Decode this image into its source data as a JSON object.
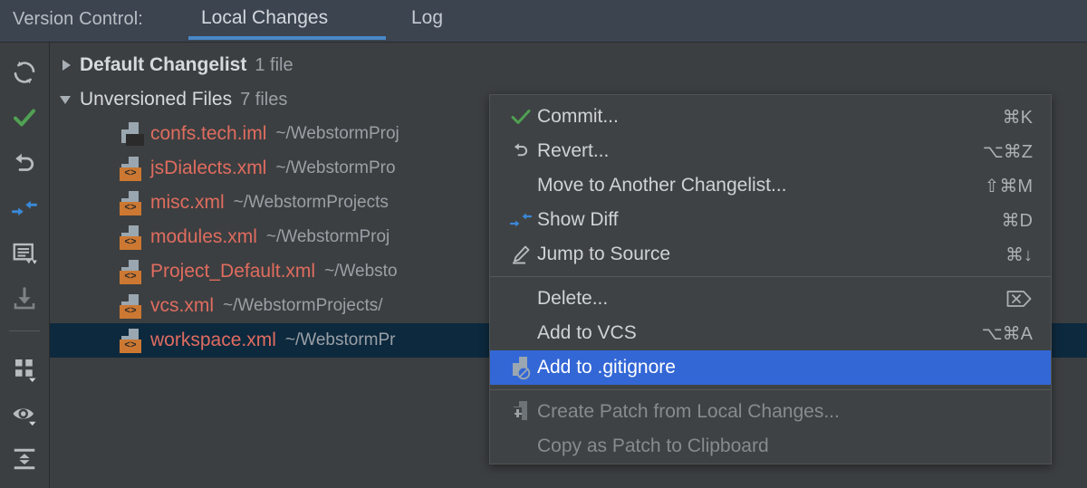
{
  "header": {
    "title": "Version Control:",
    "tabs": [
      {
        "label": "Local Changes",
        "active": true
      },
      {
        "label": "Log",
        "active": false
      }
    ]
  },
  "toolbar": {
    "items": [
      {
        "name": "refresh-icon",
        "label": "Refresh"
      },
      {
        "name": "commit-check-icon",
        "label": "Commit"
      },
      {
        "name": "revert-icon",
        "label": "Revert"
      },
      {
        "name": "show-diff-icon",
        "label": "Show Diff"
      },
      {
        "name": "comment-icon",
        "label": "Edit Changelist"
      },
      {
        "name": "shelve-icon",
        "label": "Shelve Silently"
      },
      {
        "name": "group-by-icon",
        "label": "Group By"
      },
      {
        "name": "preview-eye-icon",
        "label": "Preview Diff"
      },
      {
        "name": "expand-collapse-icon",
        "label": "Expand / Collapse"
      }
    ]
  },
  "tree": {
    "groups": [
      {
        "name": "Default Changelist",
        "count": "1 file",
        "expanded": false,
        "bold": true
      },
      {
        "name": "Unversioned Files",
        "count": "7 files",
        "expanded": true,
        "bold": false
      }
    ],
    "files": [
      {
        "name": "confs.tech.iml",
        "path": "~/WebstormProj",
        "icon": "iml-file-icon",
        "selected": false
      },
      {
        "name": "jsDialects.xml",
        "path": "~/WebstormPro",
        "icon": "xml-file-icon",
        "selected": false
      },
      {
        "name": "misc.xml",
        "path": "~/WebstormProjects",
        "icon": "xml-file-icon",
        "selected": false
      },
      {
        "name": "modules.xml",
        "path": "~/WebstormProj",
        "icon": "xml-file-icon",
        "selected": false
      },
      {
        "name": "Project_Default.xml",
        "path": "~/Websto",
        "icon": "xml-file-icon",
        "selected": false
      },
      {
        "name": "vcs.xml",
        "path": "~/WebstormProjects/",
        "icon": "xml-file-icon",
        "selected": false
      },
      {
        "name": "workspace.xml",
        "path": "~/WebstormPr",
        "icon": "xml-file-icon",
        "selected": true
      }
    ]
  },
  "context_menu": {
    "items": [
      {
        "label": "Commit...",
        "shortcut": "⌘K",
        "icon": "green-check-icon",
        "state": "enabled"
      },
      {
        "label": "Revert...",
        "shortcut": "⌥⌘Z",
        "icon": "revert-arrow-icon",
        "state": "enabled"
      },
      {
        "label": "Move to Another Changelist...",
        "shortcut": "⇧⌘M",
        "icon": "none",
        "state": "enabled"
      },
      {
        "label": "Show Diff",
        "shortcut": "⌘D",
        "icon": "show-diff-icon",
        "state": "enabled"
      },
      {
        "label": "Jump to Source",
        "shortcut": "⌘↓",
        "icon": "pencil-icon",
        "state": "enabled"
      },
      {
        "separator": true
      },
      {
        "label": "Delete...",
        "shortcut": "⌧",
        "icon": "none",
        "state": "enabled"
      },
      {
        "label": "Add to VCS",
        "shortcut": "⌥⌘A",
        "icon": "none",
        "state": "enabled"
      },
      {
        "label": "Add to .gitignore",
        "shortcut": "",
        "icon": "ignore-file-icon",
        "state": "highlighted"
      },
      {
        "separator": true
      },
      {
        "label": "Create Patch from Local Changes...",
        "shortcut": "",
        "icon": "patch-file-icon",
        "state": "disabled"
      },
      {
        "label": "Copy as Patch to Clipboard",
        "shortcut": "",
        "icon": "none",
        "state": "disabled"
      }
    ]
  },
  "colors": {
    "header_bg": "#3c4450",
    "panel_bg": "#3c3f41",
    "menu_bg": "#3f4244",
    "accent_blue": "#4a88c7",
    "highlight_blue": "#3367d6",
    "selection_blue": "#0d293e",
    "file_red": "#e06c5f",
    "badge_orange": "#cc7832",
    "green_check": "#4fa153"
  }
}
